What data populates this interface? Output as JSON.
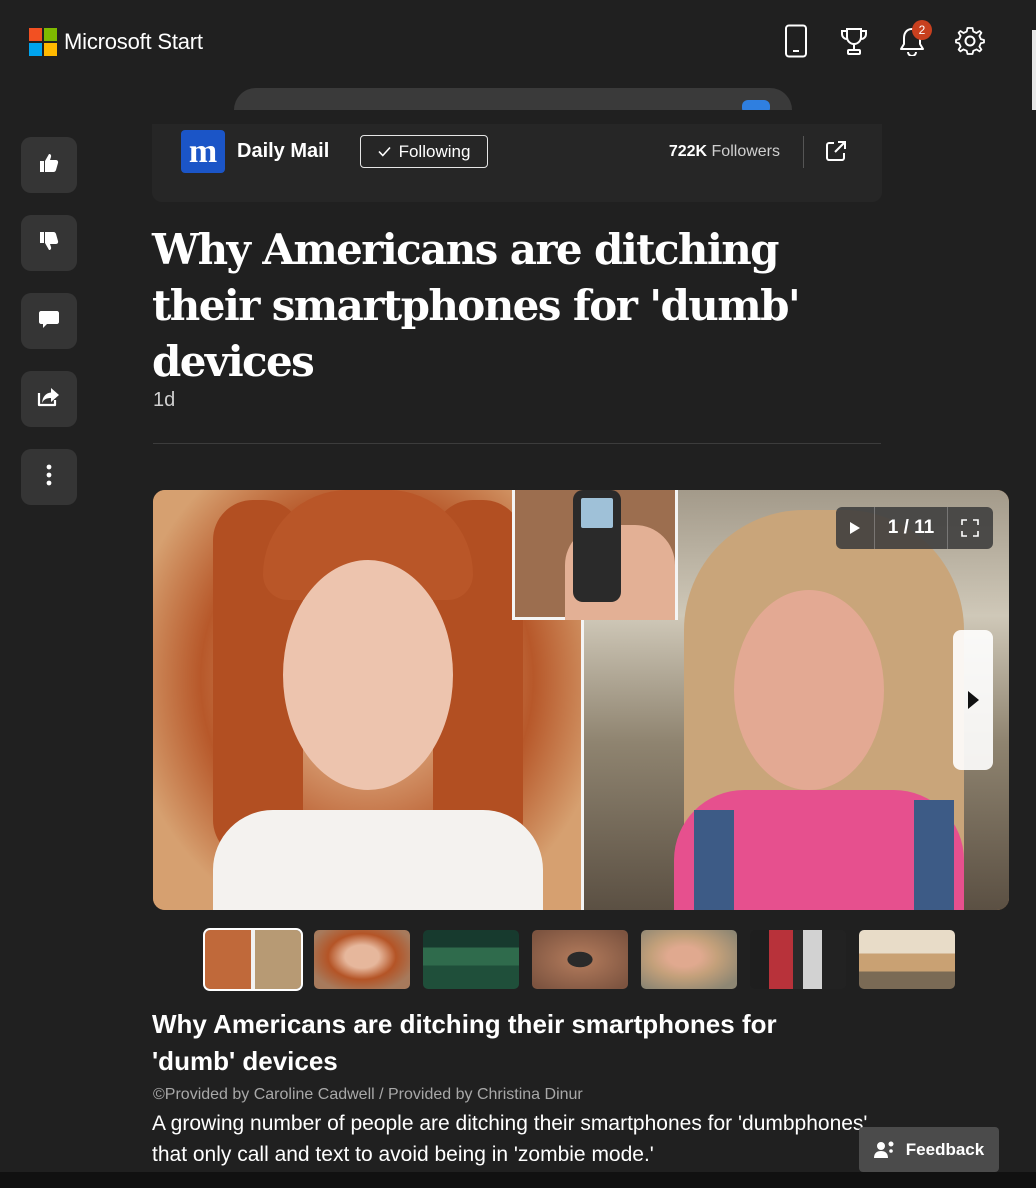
{
  "app": {
    "logo_text": "Microsoft Start",
    "logo_colors": [
      "#f25022",
      "#7fba00",
      "#00a4ef",
      "#ffb900"
    ]
  },
  "topbar": {
    "icons": [
      "phone-icon",
      "trophy-icon",
      "bell-icon",
      "gear-icon"
    ],
    "notification_count": "2"
  },
  "rail": {
    "buttons": [
      "thumbs-up-icon",
      "thumbs-down-icon",
      "comment-icon",
      "share-icon",
      "more-icon"
    ]
  },
  "publisher": {
    "logo_letter": "m",
    "name": "Daily Mail",
    "follow_label": "Following",
    "followers_count": "722K",
    "followers_label": "Followers"
  },
  "article": {
    "headline": "Why Americans are ditching their smartphones for 'dumb' devices",
    "age": "1d"
  },
  "gallery": {
    "counter": "1 / 11",
    "thumbnail_count": 7
  },
  "caption": {
    "title": "Why Americans are ditching their smartphones for 'dumb' devices",
    "credit": "©Provided by Caroline Cadwell / Provided by Christina Dinur",
    "description": "A growing number of people are ditching their smartphones for 'dumbphones' that only call and text to avoid being in 'zombie mode.'"
  },
  "feedback": {
    "label": "Feedback"
  },
  "colors": {
    "background": "#202020",
    "rail_button": "#353535",
    "publisher_blue": "#1b55c7",
    "badge": "#c8401f"
  }
}
